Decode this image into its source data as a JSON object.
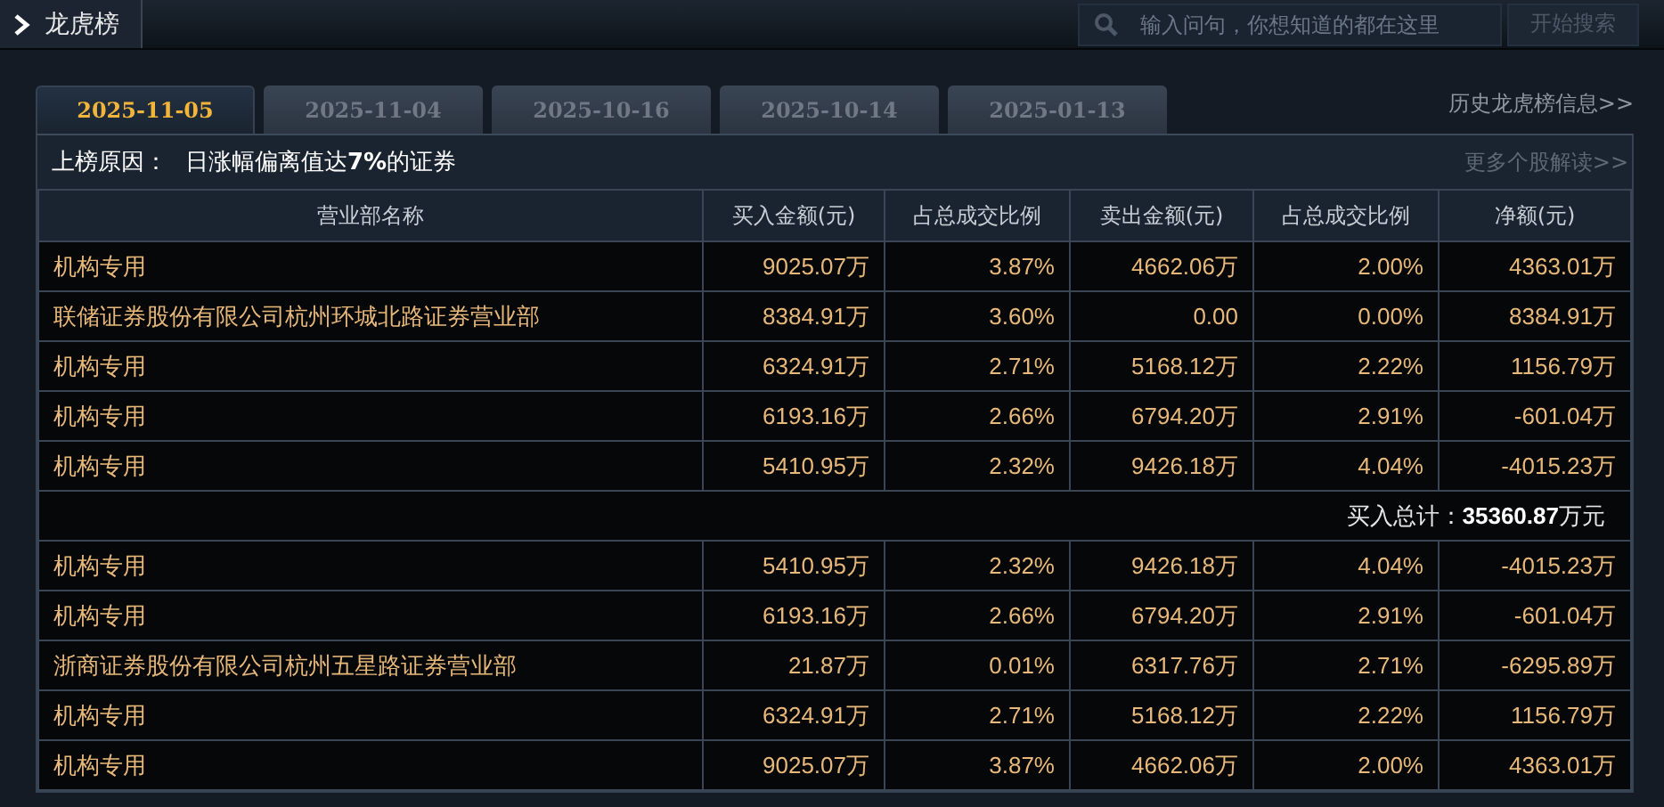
{
  "header": {
    "title": "龙虎榜",
    "search": {
      "placeholder": "输入问句，你想知道的都在这里"
    },
    "search_button": "开始搜索"
  },
  "tabs": [
    {
      "label": "2025-11-05",
      "selected": true
    },
    {
      "label": "2025-11-04",
      "selected": false
    },
    {
      "label": "2025-10-16",
      "selected": false
    },
    {
      "label": "2025-10-14",
      "selected": false
    },
    {
      "label": "2025-01-13",
      "selected": false
    }
  ],
  "history_link": "历史龙虎榜信息>>",
  "reason": {
    "label": "上榜原因：",
    "text": "日涨幅偏离值达**7%**的证券"
  },
  "more_link": "更多个股解读>>",
  "table": {
    "columns": [
      "营业部名称",
      "买入金额(元)",
      "占总成交比例",
      "卖出金额(元)",
      "占总成交比例",
      "净额(元)"
    ],
    "buy_rows": [
      [
        "机构专用",
        "9025.07万",
        "3.87%",
        "4662.06万",
        "2.00%",
        "4363.01万"
      ],
      [
        "联储证券股份有限公司杭州环城北路证券营业部",
        "8384.91万",
        "3.60%",
        "0.00",
        "0.00%",
        "8384.91万"
      ],
      [
        "机构专用",
        "6324.91万",
        "2.71%",
        "5168.12万",
        "2.22%",
        "1156.79万"
      ],
      [
        "机构专用",
        "6193.16万",
        "2.66%",
        "6794.20万",
        "2.91%",
        "-601.04万"
      ],
      [
        "机构专用",
        "5410.95万",
        "2.32%",
        "9426.18万",
        "4.04%",
        "-4015.23万"
      ]
    ],
    "buy_total": {
      "label": "买入总计：",
      "value": "35360.87",
      "unit": "万元"
    },
    "sell_rows": [
      [
        "机构专用",
        "5410.95万",
        "2.32%",
        "9426.18万",
        "4.04%",
        "-4015.23万"
      ],
      [
        "机构专用",
        "6193.16万",
        "2.66%",
        "6794.20万",
        "2.91%",
        "-601.04万"
      ],
      [
        "浙商证券股份有限公司杭州五星路证券营业部",
        "21.87万",
        "0.01%",
        "6317.76万",
        "2.71%",
        "-6295.89万"
      ],
      [
        "机构专用",
        "6324.91万",
        "2.71%",
        "5168.12万",
        "2.22%",
        "1156.79万"
      ],
      [
        "机构专用",
        "9025.07万",
        "3.87%",
        "4662.06万",
        "2.00%",
        "4363.01万"
      ]
    ]
  }
}
